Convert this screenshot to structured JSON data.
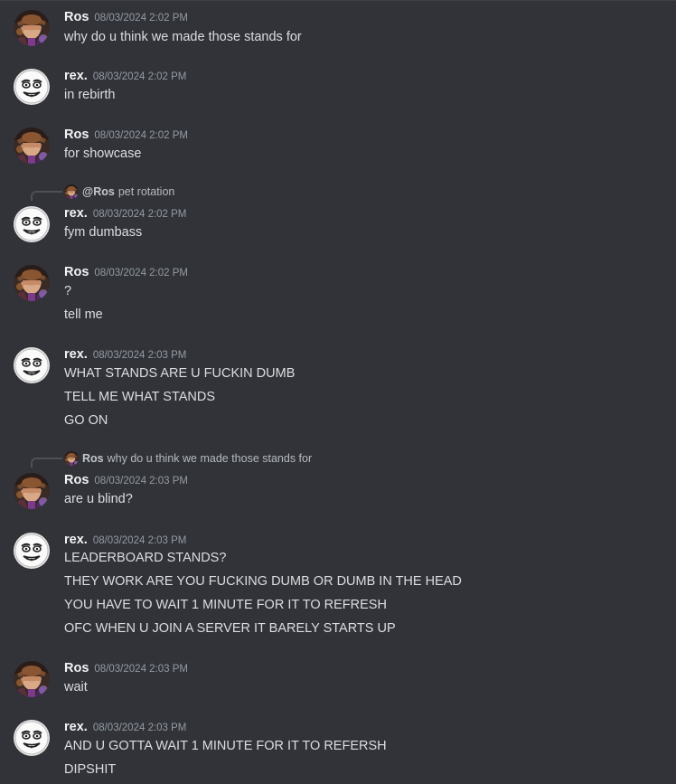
{
  "messages": [
    {
      "user": "Ros",
      "time": "08/03/2024 2:02 PM",
      "lines": [
        "why do u think we made those stands for"
      ]
    },
    {
      "user": "rex.",
      "time": "08/03/2024 2:02 PM",
      "lines": [
        "in rebirth"
      ]
    },
    {
      "user": "Ros",
      "time": "08/03/2024 2:02 PM",
      "lines": [
        "for showcase"
      ]
    },
    {
      "user": "rex.",
      "time": "08/03/2024 2:02 PM",
      "reply": {
        "name": "@Ros",
        "text": "pet rotation"
      },
      "lines": [
        "fym dumbass"
      ]
    },
    {
      "user": "Ros",
      "time": "08/03/2024 2:02 PM",
      "lines": [
        "?",
        "tell me"
      ]
    },
    {
      "user": "rex.",
      "time": "08/03/2024 2:03 PM",
      "lines": [
        "WHAT STANDS ARE U FUCKIN DUMB",
        "TELL ME WHAT STANDS",
        "GO ON"
      ]
    },
    {
      "user": "Ros",
      "time": "08/03/2024 2:03 PM",
      "reply": {
        "name": "Ros",
        "text": "why do u think we made those stands for"
      },
      "lines": [
        "are u blind?"
      ]
    },
    {
      "user": "rex.",
      "time": "08/03/2024 2:03 PM",
      "lines": [
        "LEADERBOARD STANDS?",
        "THEY WORK ARE YOU FUCKING DUMB OR DUMB IN THE HEAD",
        "YOU HAVE TO WAIT 1 MINUTE FOR IT TO REFRESH",
        "OFC WHEN U JOIN A SERVER IT BARELY STARTS UP"
      ]
    },
    {
      "user": "Ros",
      "time": "08/03/2024 2:03 PM",
      "lines": [
        "wait"
      ]
    },
    {
      "user": "rex.",
      "time": "08/03/2024 2:03 PM",
      "lines": [
        "AND U GOTTA WAIT 1 MINUTE FOR IT TO REFERSH",
        "DIPSHIT"
      ]
    }
  ],
  "avatars": {
    "Ros": "ros-avatar-icon",
    "rex.": "rex-avatar-icon"
  }
}
